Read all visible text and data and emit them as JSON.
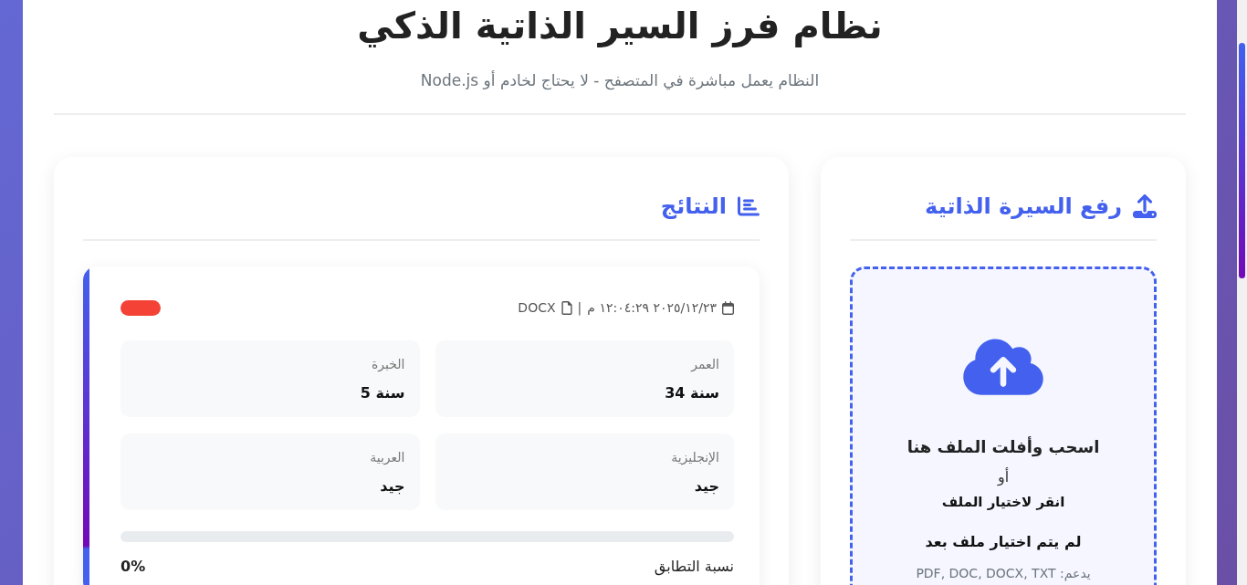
{
  "header": {
    "title": "نظام فرز السير الذاتية الذكي",
    "subtitle": "النظام يعمل مباشرة في المتصفح - لا يحتاج لخادم أو Node.js"
  },
  "upload_panel": {
    "title": "رفع السيرة الذاتية",
    "drop_zone": {
      "heading": "اسحب وأفلت الملف هنا",
      "separator": "أو",
      "action": "انقر لاختيار الملف",
      "file_status": "لم يتم اختيار ملف بعد",
      "supported": "يدعم: PDF, DOC, DOCX, TXT"
    }
  },
  "results_panel": {
    "title": "النتائج",
    "results": [
      {
        "color": "#f44336",
        "datetime": "٢٣‏/١٢‏/٢٠٢٥ ١٢:٠٤:٢٩ م",
        "separator": "|",
        "file_type": "DOCX",
        "fields": [
          {
            "label": "العمر",
            "value": "34 سنة"
          },
          {
            "label": "الخبرة",
            "value": "5 سنة"
          },
          {
            "label": "الإنجليزية",
            "value": "جيد"
          },
          {
            "label": "العربية",
            "value": "جيد"
          }
        ],
        "match": {
          "label": "نسبة التطابق",
          "reading": "0%"
        }
      }
    ]
  }
}
